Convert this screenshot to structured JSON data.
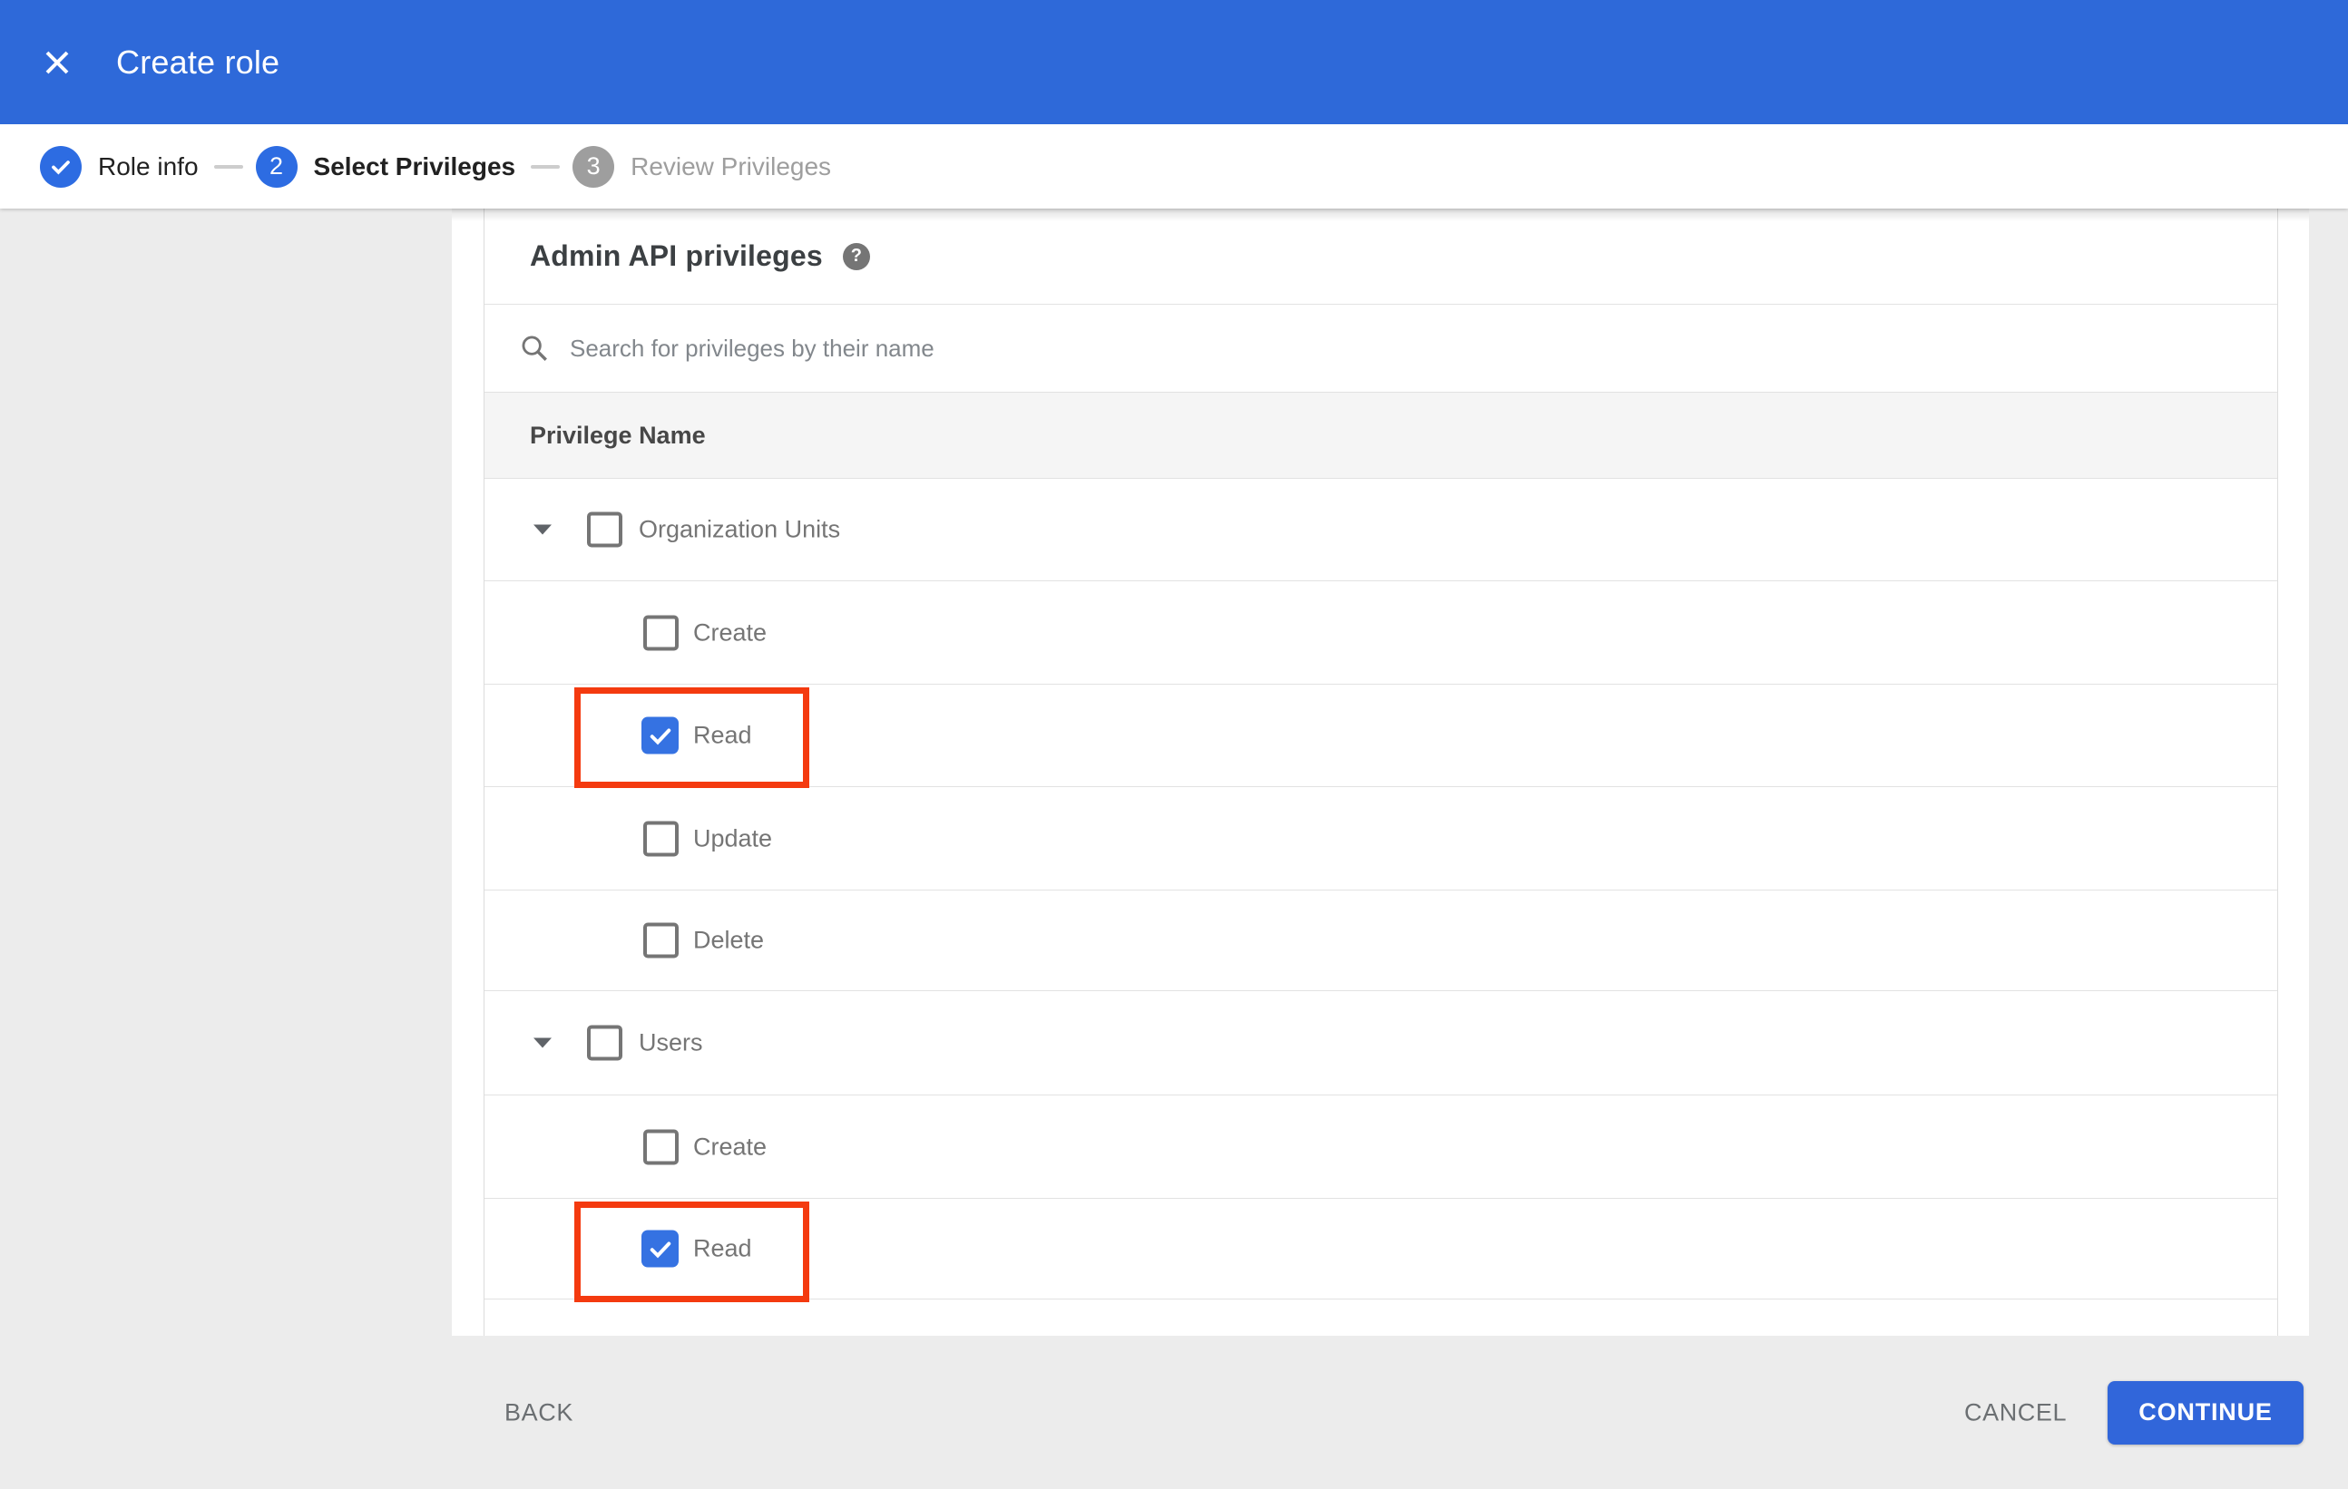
{
  "appbar": {
    "title": "Create role",
    "close_icon": "x-icon"
  },
  "stepper": {
    "steps": [
      {
        "number": "",
        "label": "Role info",
        "state": "complete",
        "icon": "check-icon"
      },
      {
        "number": "2",
        "label": "Select Privileges",
        "state": "active"
      },
      {
        "number": "3",
        "label": "Review Privileges",
        "state": "upcoming"
      }
    ]
  },
  "content": {
    "heading": "Admin API privileges",
    "help_icon": "question-mark-icon",
    "search_icon": "magnifier-icon",
    "search_placeholder": "Search for privileges by their name",
    "table_header": "Privilege Name"
  },
  "privileges": [
    {
      "label": "Organization Units",
      "type": "group",
      "checked": false,
      "expanded": true,
      "highlighted": false
    },
    {
      "label": "Create",
      "type": "item",
      "checked": false,
      "highlighted": false
    },
    {
      "label": "Read",
      "type": "item",
      "checked": true,
      "highlighted": true
    },
    {
      "label": "Update",
      "type": "item",
      "checked": false,
      "highlighted": false
    },
    {
      "label": "Delete",
      "type": "item",
      "checked": false,
      "highlighted": false
    },
    {
      "label": "Users",
      "type": "group",
      "checked": false,
      "expanded": true,
      "highlighted": false
    },
    {
      "label": "Create",
      "type": "item",
      "checked": false,
      "highlighted": false
    },
    {
      "label": "Read",
      "type": "item",
      "checked": true,
      "highlighted": true
    }
  ],
  "footer": {
    "back_label": "BACK",
    "cancel_label": "CANCEL",
    "continue_label": "CONTINUE"
  },
  "colors": {
    "appbar_blue": "#2e69d9",
    "accent_blue": "#2d6ce2",
    "checkbox_blue": "#3572e2",
    "continue_blue": "#3166da",
    "highlight_red": "#f43a0f",
    "page_gray": "#ececec"
  }
}
